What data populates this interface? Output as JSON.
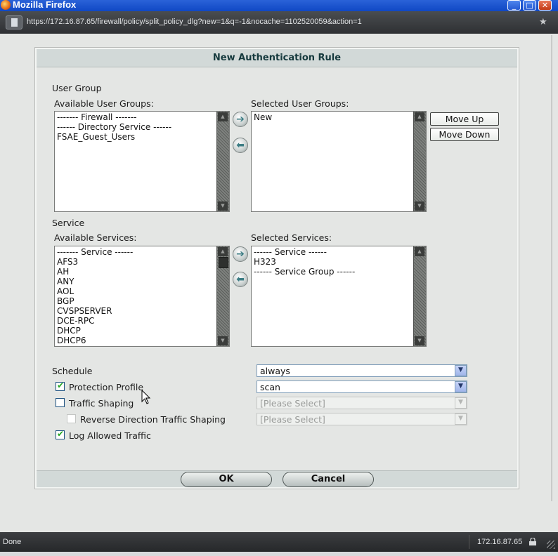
{
  "window": {
    "title": "Mozilla Firefox",
    "minimize_glyph": "_",
    "maximize_glyph": "□",
    "close_glyph": "✕",
    "url": "https://172.16.87.65/firewall/policy/split_policy_dlg?new=1&q=-1&nocache=1102520059&action=1",
    "bookmark_glyph": "★"
  },
  "dialog": {
    "title": "New Authentication Rule",
    "user_group": {
      "section_label": "User Group",
      "available_label": "Available User Groups:",
      "available_items": [
        "------- Firewall -------",
        "------ Directory Service ------",
        "FSAE_Guest_Users"
      ],
      "selected_label": "Selected User Groups:",
      "selected_items": [
        "New"
      ],
      "move_up_label": "Move Up",
      "move_down_label": "Move Down",
      "add_glyph": "➔",
      "remove_glyph": "⬅"
    },
    "service": {
      "section_label": "Service",
      "available_label": "Available Services:",
      "available_items": [
        "------- Service ------",
        "AFS3",
        "AH",
        "ANY",
        "AOL",
        "BGP",
        "CVSPSERVER",
        "DCE-RPC",
        "DHCP",
        "DHCP6"
      ],
      "selected_label": "Selected Services:",
      "selected_items": [
        "------ Service ------",
        "H323",
        "------ Service Group ------"
      ],
      "add_glyph": "➔",
      "remove_glyph": "⬅"
    },
    "schedule": {
      "label": "Schedule",
      "value": "always"
    },
    "protection_profile": {
      "label": "Protection Profile",
      "checked": true,
      "value": "scan"
    },
    "traffic_shaping": {
      "label": "Traffic Shaping",
      "checked": false,
      "value": "[Please Select]"
    },
    "reverse_shaping": {
      "label": "Reverse Direction Traffic Shaping",
      "checked": false,
      "value": "[Please Select]"
    },
    "log_allowed": {
      "label": "Log Allowed Traffic",
      "checked": true
    },
    "check_glyph": "✔",
    "dropdown_glyph": "▼",
    "ok_label": "OK",
    "cancel_label": "Cancel"
  },
  "statusbar": {
    "status": "Done",
    "host": "172.16.87.65"
  },
  "icons": [
    "firefox-icon",
    "page-icon",
    "star-icon",
    "arrow-right-icon",
    "arrow-left-icon",
    "lock-icon",
    "mouse-cursor-icon"
  ]
}
